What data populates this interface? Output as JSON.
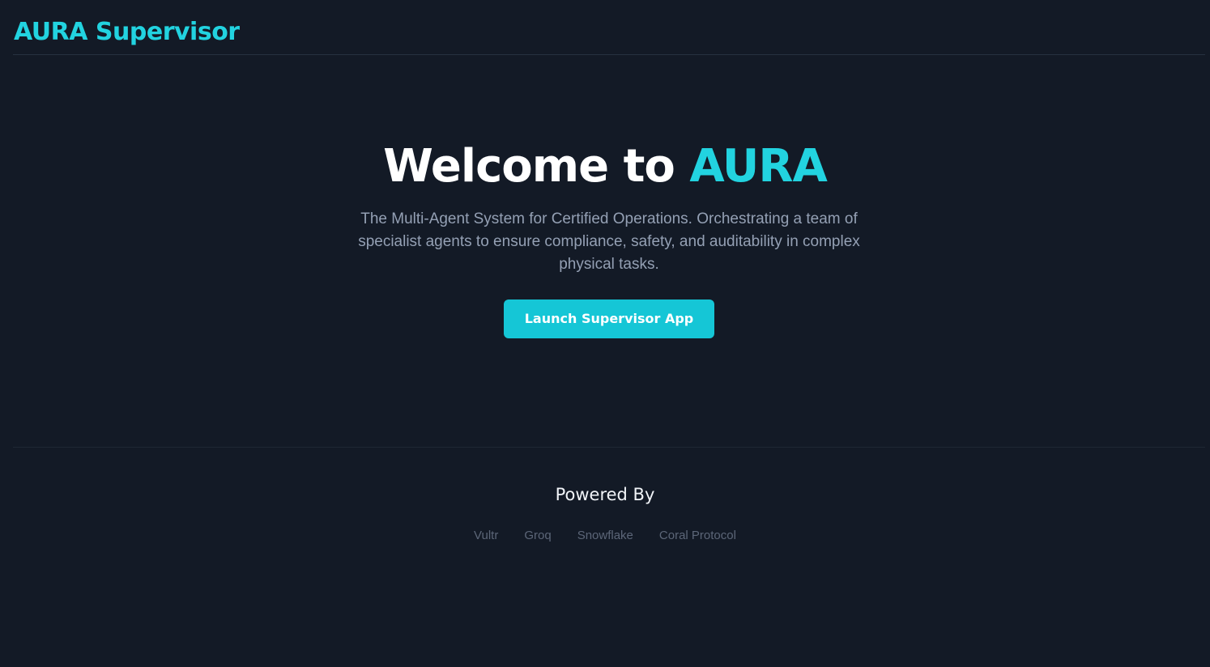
{
  "header": {
    "brand": "AURA Supervisor"
  },
  "hero": {
    "title_prefix": "Welcome to ",
    "title_accent": "AURA",
    "description": "The Multi-Agent System for Certified Operations. Orchestrating a team of specialist agents to ensure compliance, safety, and auditability in complex physical tasks.",
    "cta_label": "Launch Supervisor App"
  },
  "footer": {
    "powered_by_title": "Powered By",
    "partners": [
      "Vultr",
      "Groq",
      "Snowflake",
      "Coral Protocol"
    ]
  },
  "colors": {
    "background": "#131a26",
    "accent": "#22d3e0",
    "button": "#15c6d6",
    "muted_text": "#94a0b4",
    "partner_text": "#5c6678"
  }
}
